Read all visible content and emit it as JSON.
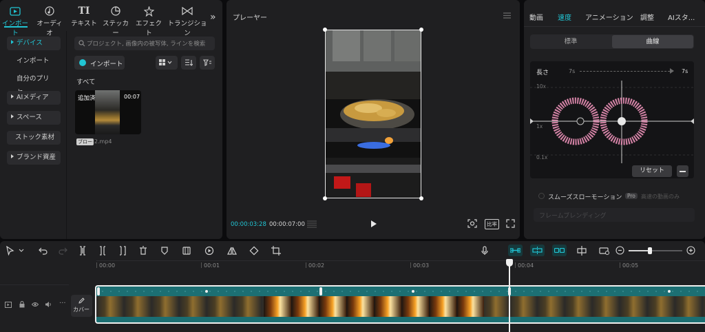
{
  "top_tabs": [
    {
      "label": "インポート",
      "icon": "import-icon",
      "active": true
    },
    {
      "label": "オーディオ",
      "icon": "audio-icon",
      "active": false
    },
    {
      "label": "テキスト",
      "icon": "text-icon",
      "active": false
    },
    {
      "label": "ステッカー",
      "icon": "sticker-icon",
      "active": false
    },
    {
      "label": "エフェクト",
      "icon": "effect-icon",
      "active": false
    },
    {
      "label": "トランジション",
      "icon": "transition-icon",
      "active": false
    }
  ],
  "sidebar": {
    "items": [
      {
        "label": "デバイス"
      },
      {
        "label": "インポート"
      },
      {
        "label": "自分のプリセ…"
      },
      {
        "label": "AIメディア"
      },
      {
        "label": "スペース"
      },
      {
        "label": "ストック素材"
      },
      {
        "label": "ブランド資産"
      }
    ]
  },
  "media": {
    "search_placeholder": "プロジェクト, 画像内の被写体, ラインを検索",
    "import_label": "インポート",
    "section_label": "すべて",
    "clip": {
      "badge": "追加済",
      "duration": "00:07",
      "tag": "ブロー",
      "filename": "-2.mp4"
    }
  },
  "player": {
    "title": "プレーヤー",
    "current_time": "00:00:03:28",
    "total_time": "00:00:07:00",
    "ratio_label": "比率"
  },
  "right": {
    "tabs": [
      "動画",
      "速度",
      "アニメーション",
      "調整",
      "AIスタ..."
    ],
    "active_tab": "速度",
    "seg": {
      "left": "標準",
      "right": "曲線"
    },
    "length_label": "長さ",
    "length_left": "7s",
    "length_right": "7s",
    "y_labels": [
      "10x",
      "1x",
      "0.1x"
    ],
    "reset_label": "リセット",
    "smooth_label": "スムーズスローモーション",
    "pro_badge": "Pro",
    "smooth_note": "高速の動画のみ",
    "frame_label": "フレームブレンディング"
  },
  "timeline": {
    "ticks": [
      "00:00",
      "00:01",
      "00:02",
      "00:03",
      "00:04",
      "00:05"
    ],
    "cover_label": "カバー"
  },
  "colors": {
    "accent": "#21c5d4",
    "clip_track": "#1b6e72",
    "panel": "#1f1f21"
  }
}
